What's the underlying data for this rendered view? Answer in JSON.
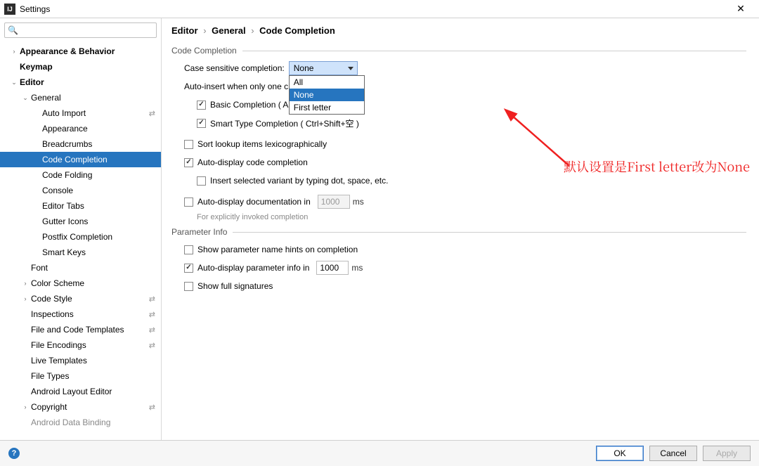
{
  "window": {
    "title": "Settings"
  },
  "search": {
    "placeholder": ""
  },
  "sidebar": {
    "items": [
      {
        "label": "Appearance & Behavior",
        "depth": 0,
        "chev": "›",
        "bold": true
      },
      {
        "label": "Keymap",
        "depth": 0,
        "chev": "",
        "bold": true
      },
      {
        "label": "Editor",
        "depth": 0,
        "chev": "⌄",
        "bold": true
      },
      {
        "label": "General",
        "depth": 1,
        "chev": "⌄"
      },
      {
        "label": "Auto Import",
        "depth": 2,
        "chev": "",
        "sync": true
      },
      {
        "label": "Appearance",
        "depth": 2,
        "chev": ""
      },
      {
        "label": "Breadcrumbs",
        "depth": 2,
        "chev": ""
      },
      {
        "label": "Code Completion",
        "depth": 2,
        "chev": "",
        "selected": true
      },
      {
        "label": "Code Folding",
        "depth": 2,
        "chev": ""
      },
      {
        "label": "Console",
        "depth": 2,
        "chev": ""
      },
      {
        "label": "Editor Tabs",
        "depth": 2,
        "chev": ""
      },
      {
        "label": "Gutter Icons",
        "depth": 2,
        "chev": ""
      },
      {
        "label": "Postfix Completion",
        "depth": 2,
        "chev": ""
      },
      {
        "label": "Smart Keys",
        "depth": 2,
        "chev": ""
      },
      {
        "label": "Font",
        "depth": 1,
        "chev": ""
      },
      {
        "label": "Color Scheme",
        "depth": 1,
        "chev": "›"
      },
      {
        "label": "Code Style",
        "depth": 1,
        "chev": "›",
        "sync": true
      },
      {
        "label": "Inspections",
        "depth": 1,
        "chev": "",
        "sync": true
      },
      {
        "label": "File and Code Templates",
        "depth": 1,
        "chev": "",
        "sync": true
      },
      {
        "label": "File Encodings",
        "depth": 1,
        "chev": "",
        "sync": true
      },
      {
        "label": "Live Templates",
        "depth": 1,
        "chev": ""
      },
      {
        "label": "File Types",
        "depth": 1,
        "chev": ""
      },
      {
        "label": "Android Layout Editor",
        "depth": 1,
        "chev": ""
      },
      {
        "label": "Copyright",
        "depth": 1,
        "chev": "›",
        "sync": true
      },
      {
        "label": "Android Data Binding",
        "depth": 1,
        "chev": "",
        "partial": true
      }
    ]
  },
  "breadcrumb": {
    "a": "Editor",
    "b": "General",
    "c": "Code Completion"
  },
  "sections": {
    "code_completion_title": "Code Completion",
    "parameter_info_title": "Parameter Info"
  },
  "cc": {
    "case_label": "Case sensitive completion:",
    "combo_value": "None",
    "combo_options": [
      "All",
      "None",
      "First letter"
    ],
    "auto_insert_label": "Auto-insert when only one c",
    "basic_label": "Basic Completion ( A",
    "smart_label": "Smart Type Completion ( Ctrl+Shift+空",
    "smart_label_tail": " )",
    "sort_label": "Sort lookup items lexicographically",
    "autodisp_label": "Auto-display code completion",
    "insert_variant_label": "Insert selected variant by typing dot, space, etc.",
    "autodoc_label": "Auto-display documentation in",
    "autodoc_value": "1000",
    "autodoc_ms": "ms",
    "autodoc_hint": "For explicitly invoked completion"
  },
  "pi": {
    "hints_label": "Show parameter name hints on completion",
    "autodisp_label": "Auto-display parameter info in",
    "autodisp_value": "1000",
    "autodisp_ms": "ms",
    "full_sig_label": "Show full signatures"
  },
  "annotation": {
    "text": "默认设置是First letter改为None"
  },
  "footer": {
    "ok": "OK",
    "cancel": "Cancel",
    "apply": "Apply"
  }
}
